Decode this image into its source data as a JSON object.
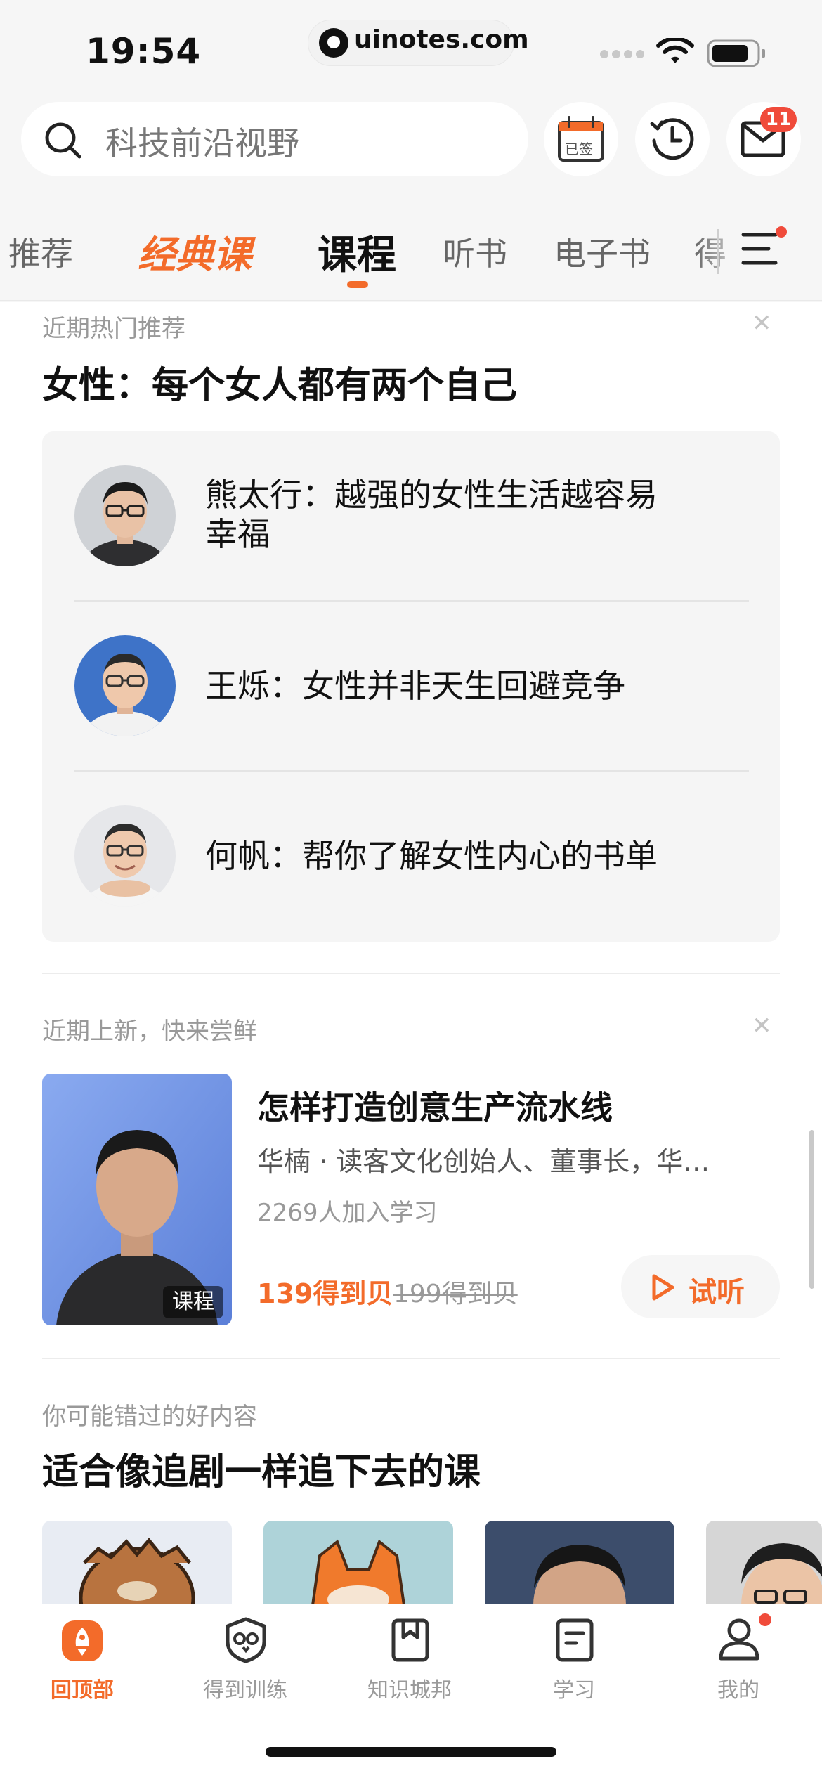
{
  "status_bar": {
    "time": "19:54",
    "url": "uinotes.com"
  },
  "search": {
    "placeholder": "科技前沿视野"
  },
  "header_buttons": {
    "checkin_label": "已签",
    "mail_badge": "11"
  },
  "tabs": [
    {
      "label": "推荐"
    },
    {
      "label": "经典课"
    },
    {
      "label": "课程",
      "active": true
    },
    {
      "label": "听书"
    },
    {
      "label": "电子书"
    },
    {
      "label": "得"
    }
  ],
  "section1": {
    "hint": "近期热门推荐",
    "title": "女性：每个女人都有两个自己",
    "items": [
      {
        "line1": "熊太行：越强的女性生活越容易",
        "line2": "幸福"
      },
      {
        "line1": "王烁：女性并非天生回避竞争"
      },
      {
        "line1": "何帆：帮你了解女性内心的书单"
      }
    ]
  },
  "section2": {
    "hint": "近期上新，快来尝鲜",
    "course": {
      "title": "怎样打造创意生产流水线",
      "subtitle": "华楠 · 读客文化创始人、董事长，华…",
      "learners": "2269人加入学习",
      "price": "139得到贝",
      "original_price": "199得到贝",
      "cover_tag": "课程",
      "try_label": "试听"
    }
  },
  "section3": {
    "hint": "你可能错过的好内容",
    "title": "适合像追剧一样追下去的课"
  },
  "bottom_nav": [
    {
      "label": "回顶部",
      "active": true
    },
    {
      "label": "得到训练"
    },
    {
      "label": "知识城邦"
    },
    {
      "label": "学习"
    },
    {
      "label": "我的"
    }
  ],
  "colors": {
    "accent": "#f36b2a",
    "badge": "#f04b3b",
    "header_bg": "#f6f6f6",
    "card_bg": "#f5f5f5"
  }
}
